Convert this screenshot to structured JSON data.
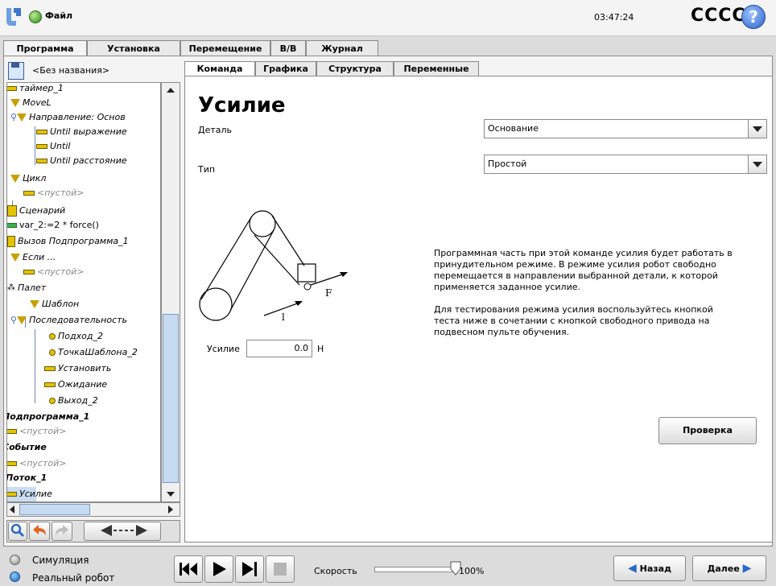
{
  "header": {
    "file_menu": "Файл",
    "clock": "03:47:24",
    "robot_name": "CCCC",
    "help": "?"
  },
  "main_tabs": [
    "Программа",
    "Установка",
    "Перемещение",
    "В/В",
    "Журнал"
  ],
  "program": {
    "name": "<Без названия>",
    "tree": [
      {
        "label": "таймер_1",
        "icon": "bar-icon"
      },
      {
        "label": "MoveL",
        "icon": "triangle-icon"
      },
      {
        "label": "Направление: Основ",
        "icon": "triangle-icon"
      },
      {
        "label": "Until выражение",
        "icon": "bar-icon"
      },
      {
        "label": "Until",
        "icon": "bar-icon"
      },
      {
        "label": "Until расстояние",
        "icon": "bar-icon"
      },
      {
        "label": "Цикл",
        "icon": "triangle-icon"
      },
      {
        "label": "<пустой>",
        "icon": "bar-icon"
      },
      {
        "label": "Сценарий",
        "icon": "script-icon"
      },
      {
        "label": "var_2:=2 * force()",
        "icon": "bar-icon"
      },
      {
        "label": "Вызов Подпрограмма_1",
        "icon": "call-icon"
      },
      {
        "label": "Если ...",
        "icon": "triangle-icon"
      },
      {
        "label": "<пустой>",
        "icon": "bar-icon"
      },
      {
        "label": "Палет",
        "icon": "pallet-icon"
      },
      {
        "label": "Шаблон",
        "icon": "triangle-icon"
      },
      {
        "label": "Последовательность",
        "icon": "triangle-icon"
      },
      {
        "label": "Подход_2",
        "icon": "dot-icon"
      },
      {
        "label": "ТочкаШаблона_2",
        "icon": "dot-icon"
      },
      {
        "label": "Установить",
        "icon": "bar-icon"
      },
      {
        "label": "Ожидание",
        "icon": "bar-icon"
      },
      {
        "label": "Выход_2",
        "icon": "dot-icon"
      },
      {
        "label": "Подпрограмма_1",
        "icon": ""
      },
      {
        "label": "<пустой>",
        "icon": "bar-icon"
      },
      {
        "label": "Событие",
        "icon": ""
      },
      {
        "label": "<пустой>",
        "icon": "bar-icon"
      },
      {
        "label": "Поток_1",
        "icon": ""
      },
      {
        "label": "Усилие",
        "icon": "bar-icon"
      }
    ]
  },
  "sub_tabs": [
    "Команда",
    "Графика",
    "Структура",
    "Переменные"
  ],
  "command": {
    "title": "Усилие",
    "part_label": "Деталь",
    "part_value": "Основание",
    "type_label": "Тип",
    "type_value": "Простой",
    "diagram_f": "F",
    "diagram_l": "l",
    "force_label": "Усилие",
    "force_value": "0.0",
    "force_unit": "Н",
    "desc_1": "Программная часть при этой команде усилия будет работать в принудительном режиме. В режиме усилия робот свободно перемещается в направлении выбранной детали, к которой применяется заданное усилие.",
    "desc_2": "Для тестирования режима усилия воспользуйтесь кнопкой теста ниже в сочетании с кнопкой свободного привода на подвесном пульте обучения.",
    "test_button": "Проверка"
  },
  "footer": {
    "simulation": "Симуляция",
    "real_robot": "Реальный робот",
    "speed_label": "Скорость",
    "speed_value": "100%",
    "back": "Назад",
    "next": "Далее"
  }
}
